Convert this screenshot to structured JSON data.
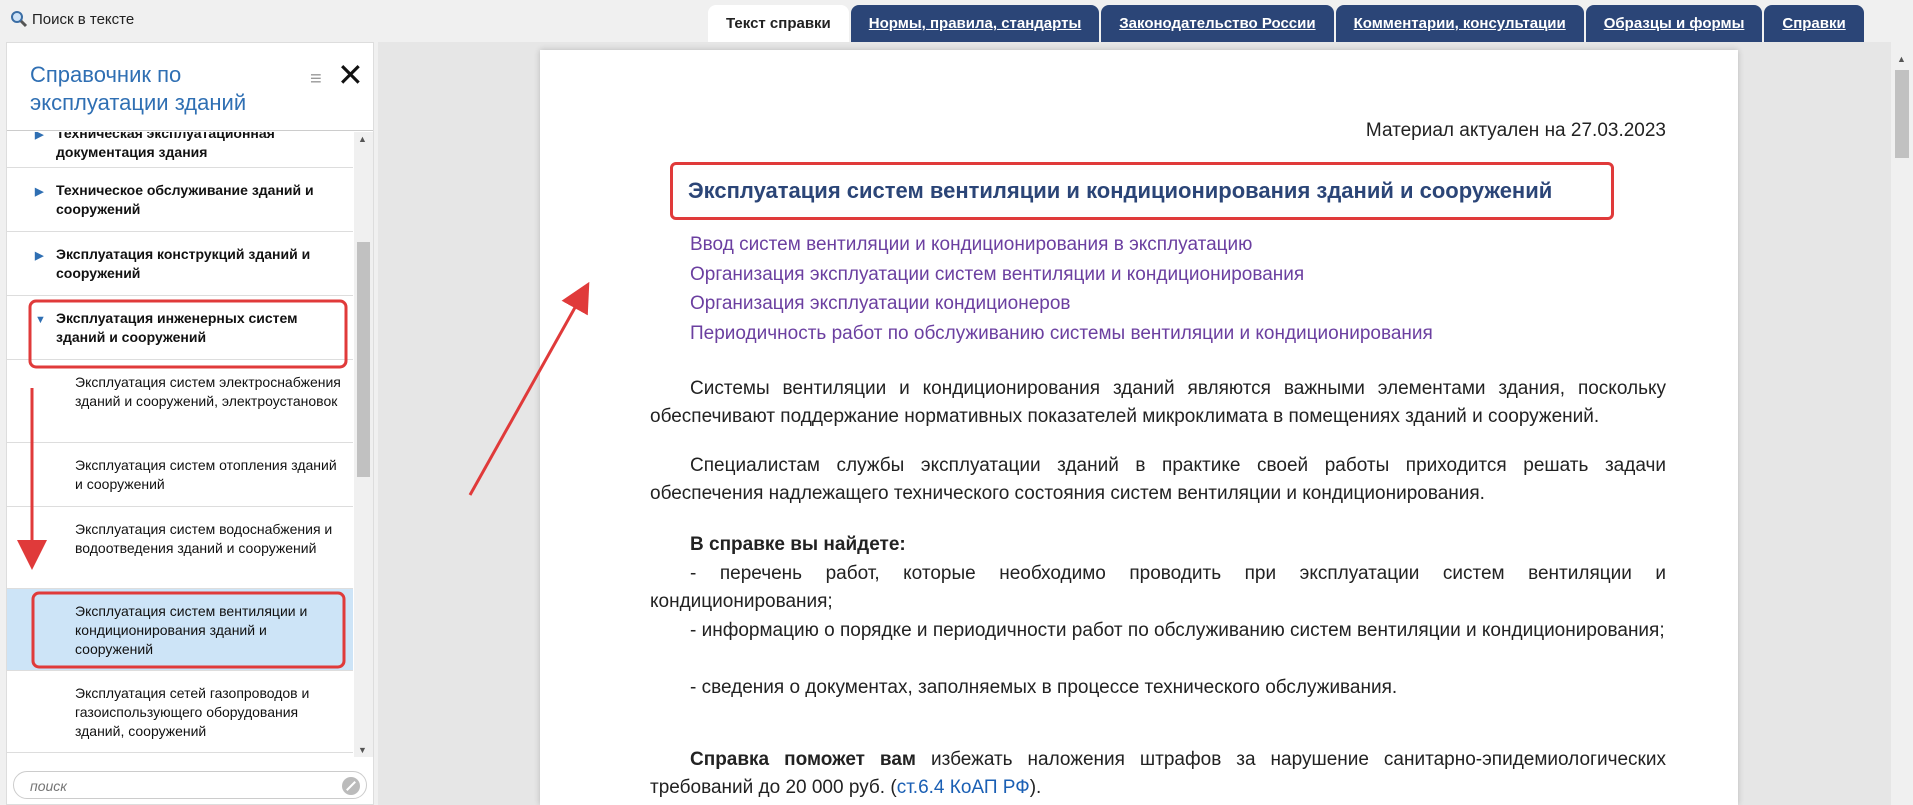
{
  "toolbar": {
    "search_label": "Поиск в тексте",
    "tabs": [
      {
        "label": "Текст справки",
        "active": true
      },
      {
        "label": "Нормы, правила, стандарты"
      },
      {
        "label": "Законодательство России"
      },
      {
        "label": "Комментарии, консультации"
      },
      {
        "label": "Образцы и формы"
      },
      {
        "label": "Справки"
      }
    ]
  },
  "sidebar": {
    "title": "Справочник по эксплуатации зданий",
    "items": [
      {
        "label": "Техническая эксплуатационная документация здания",
        "level": 1
      },
      {
        "label": "Техническое обслуживание зданий и сооружений",
        "level": 1
      },
      {
        "label": "Эксплуатация конструкций зданий и сооружений",
        "level": 1
      },
      {
        "label": "Эксплуатация инженерных систем зданий и сооружений",
        "level": 1,
        "expanded": true
      },
      {
        "label": "Эксплуатация систем электроснабжения зданий и сооружений, электроустановок",
        "level": 2
      },
      {
        "label": "Эксплуатация систем отопления зданий и сооружений",
        "level": 2
      },
      {
        "label": "Эксплуатация систем водоснабжения и водоотведения зданий и сооружений",
        "level": 2
      },
      {
        "label": "Эксплуатация систем вентиляции и кондиционирования зданий и сооружений",
        "level": 2,
        "selected": true
      },
      {
        "label": "Эксплуатация сетей газопроводов и газоиспользующего оборудования зданий, сооружений",
        "level": 2
      }
    ],
    "search_placeholder": "поиск"
  },
  "document": {
    "date_line": "Материал актуален на 27.03.2023",
    "title": "Эксплуатация систем вентиляции и кондиционирования зданий и сооружений",
    "toc": [
      "Ввод систем вентиляции и кондиционирования в эксплуатацию",
      "Организация эксплуатации систем вентиляции и кондиционирования",
      "Организация эксплуатации кондиционеров",
      "Периодичность работ по обслуживанию системы вентиляции и кондиционирования"
    ],
    "para1": "Системы вентиляции и кондиционирования зданий являются важными элементами здания, поскольку обеспечивают поддержание нормативных показателей микроклимата в помещениях зданий и сооружений.",
    "para2": "Специалистам службы эксплуатации зданий в практике своей работы приходится решать задачи обеспечения надлежащего технического состояния систем вентиляции и кондиционирования.",
    "find_heading": "В справке вы найдете:",
    "find_items": [
      "- перечень работ, которые необходимо проводить при эксплуатации систем вентиляции и кондиционирования;",
      "- информацию о порядке и периодичности работ по обслуживанию систем вентиляции и кондиционирования;",
      "- сведения о документах, заполняемых в процессе технического обслуживания."
    ],
    "help_bold": "Справка поможет вам",
    "help_text": " избежать наложения штрафов за нарушение санитарно-эпидемиологических требований до 20 000 руб. (",
    "help_link": "ст.6.4 КоАП РФ",
    "help_end": ")."
  },
  "colors": {
    "tab_bg": "#2b4577",
    "annotation": "#e03a3a",
    "toc_link": "#6b3fa0",
    "title": "#2b4577"
  }
}
